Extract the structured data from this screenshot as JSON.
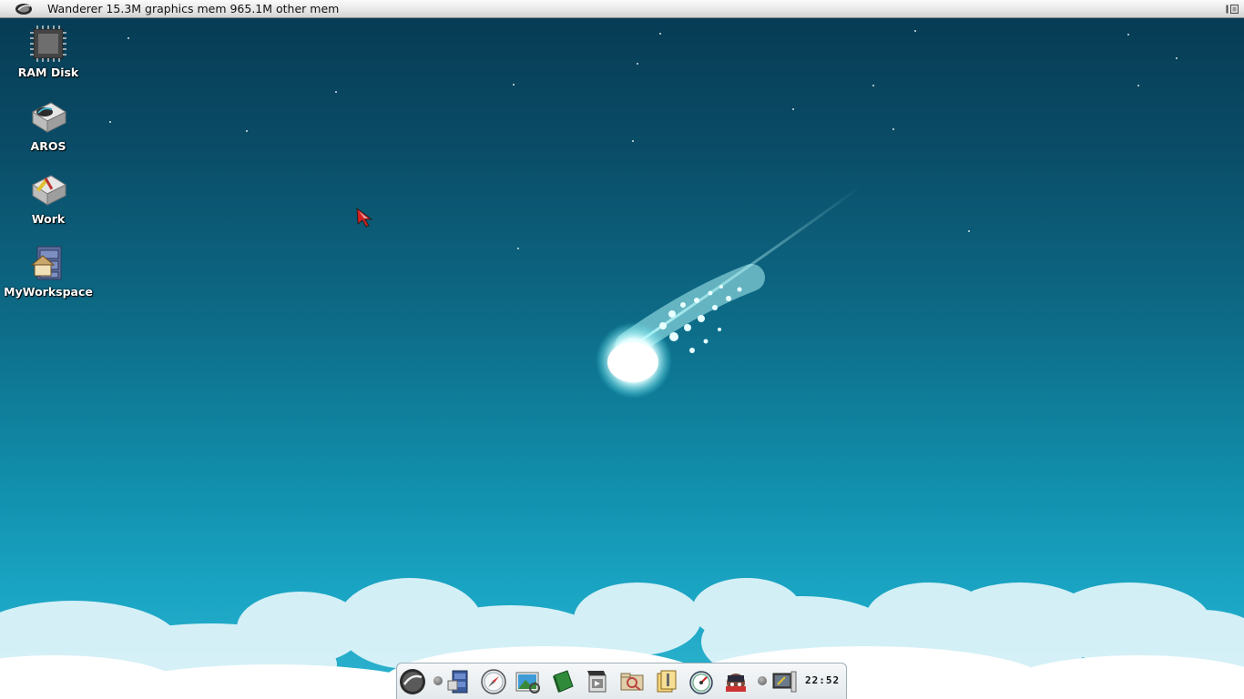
{
  "screen": {
    "title": "Wanderer 15.3M graphics mem 965.1M other mem"
  },
  "desktop_icons": [
    {
      "label": "RAM Disk",
      "icon": "chip-icon"
    },
    {
      "label": "AROS",
      "icon": "drive-icon"
    },
    {
      "label": "Work",
      "icon": "drive-icon"
    },
    {
      "label": "MyWorkspace",
      "icon": "cabinet-icon"
    }
  ],
  "dock": {
    "items": [
      "aros-menu-icon",
      "file-manager-icon",
      "browser-compass-icon",
      "image-viewer-icon",
      "book-icon",
      "media-player-icon",
      "search-folder-icon",
      "archive-icon",
      "system-monitor-icon",
      "game-icon",
      "display-prefs-icon"
    ],
    "clock": "22:52"
  }
}
